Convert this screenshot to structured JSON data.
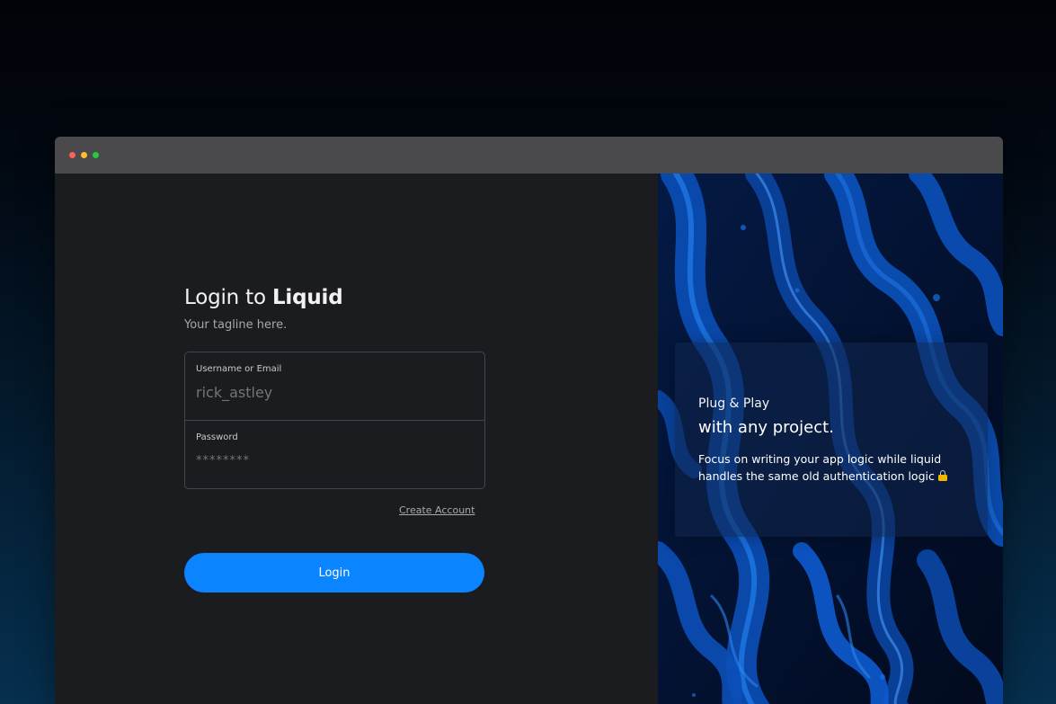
{
  "window": {
    "controls": [
      "close",
      "minimize",
      "maximize"
    ]
  },
  "login": {
    "title_prefix": "Login to ",
    "title_brand": "Liquid",
    "tagline": "Your tagline here.",
    "username_label": "Username or Email",
    "username_placeholder": "rick_astley",
    "password_label": "Password",
    "password_placeholder": "********",
    "create_account_label": "Create Account",
    "login_button_label": "Login"
  },
  "promo": {
    "line1": "Plug & Play",
    "line2": "with any project.",
    "description": "Focus on writing your app logic while liquid handles the same old authentication logic",
    "icon": "lock-icon"
  },
  "colors": {
    "accent": "#0a84ff",
    "background": "#1b1c20",
    "liquid_blue": "#0a3d91"
  }
}
